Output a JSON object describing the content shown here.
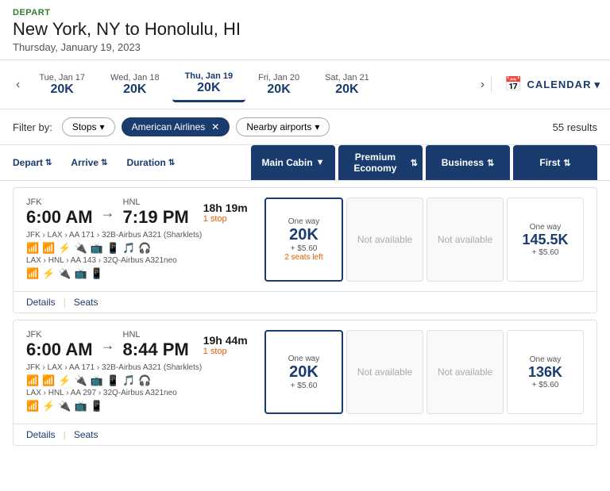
{
  "header": {
    "depart_label": "DEPART",
    "route": "New York, NY to Honolulu, HI",
    "date": "Thursday, January 19, 2023"
  },
  "calendar": {
    "prev_label": "‹",
    "next_label": "›",
    "days": [
      {
        "label": "Tue, Jan 17",
        "price": "20K",
        "selected": false
      },
      {
        "label": "Wed, Jan 18",
        "price": "20K",
        "selected": false
      },
      {
        "label": "Thu, Jan 19",
        "price": "20K",
        "selected": true
      },
      {
        "label": "Fri, Jan 20",
        "price": "20K",
        "selected": false
      },
      {
        "label": "Sat, Jan 21",
        "price": "20K",
        "selected": false
      }
    ],
    "calendar_btn": "CALENDAR"
  },
  "filters": {
    "label": "Filter by:",
    "buttons": [
      {
        "label": "Stops",
        "active": false
      },
      {
        "label": "American Airlines",
        "active": true
      },
      {
        "label": "Nearby airports",
        "active": false
      }
    ],
    "results": "55 results"
  },
  "columns": {
    "depart": "Depart",
    "arrive": "Arrive",
    "duration": "Duration",
    "cabins": [
      {
        "label": "Main Cabin",
        "sort": "▼"
      },
      {
        "label": "Premium Economy",
        "sort": "⇅"
      },
      {
        "label": "Business",
        "sort": "⇅"
      },
      {
        "label": "First",
        "sort": "⇅"
      }
    ]
  },
  "flights": [
    {
      "id": "flight-1",
      "depart_code": "JFK",
      "depart_time": "6:00 AM",
      "arrive_code": "HNL",
      "arrive_time": "7:19 PM",
      "duration": "18h 19m",
      "stops": "1 stop",
      "route1": "JFK › LAX › AA 171 › 32B-Airbus A321 (Sharklets)",
      "route2": "LAX › HNL › AA 143 › 32Q-Airbus A321neo",
      "amenities1": [
        "📶",
        "📶",
        "⚡",
        "🔌",
        "📺",
        "📱",
        "🎵",
        "🎧"
      ],
      "amenities2": [
        "📶",
        "⚡",
        "🔌",
        "📺",
        "📱"
      ],
      "prices": [
        {
          "type": "main",
          "one_way": "One way",
          "amount": "20K",
          "fee": "+ $5.60",
          "seats": "2 seats left",
          "available": true
        },
        {
          "type": "premium",
          "available": false,
          "label": "Not available"
        },
        {
          "type": "business",
          "available": false,
          "label": "Not available"
        },
        {
          "type": "first",
          "one_way": "One way",
          "amount": "145.5K",
          "fee": "+ $5.60",
          "available": true
        }
      ],
      "footer": [
        "Details",
        "Seats"
      ]
    },
    {
      "id": "flight-2",
      "depart_code": "JFK",
      "depart_time": "6:00 AM",
      "arrive_code": "HNL",
      "arrive_time": "8:44 PM",
      "duration": "19h 44m",
      "stops": "1 stop",
      "route1": "JFK › LAX › AA 171 › 32B-Airbus A321 (Sharklets)",
      "route2": "LAX › HNL › AA 297 › 32Q-Airbus A321neo",
      "amenities1": [
        "📶",
        "📶",
        "⚡",
        "🔌",
        "📺",
        "📱",
        "🎵",
        "🎧"
      ],
      "amenities2": [
        "📶",
        "⚡",
        "🔌",
        "📺",
        "📱"
      ],
      "prices": [
        {
          "type": "main",
          "one_way": "One way",
          "amount": "20K",
          "fee": "+ $5.60",
          "seats": "",
          "available": true
        },
        {
          "type": "premium",
          "available": false,
          "label": "Not available"
        },
        {
          "type": "business",
          "available": false,
          "label": "Not available"
        },
        {
          "type": "first",
          "one_way": "One way",
          "amount": "136K",
          "fee": "+ $5.60",
          "available": true
        }
      ],
      "footer": [
        "Details",
        "Seats"
      ]
    }
  ]
}
